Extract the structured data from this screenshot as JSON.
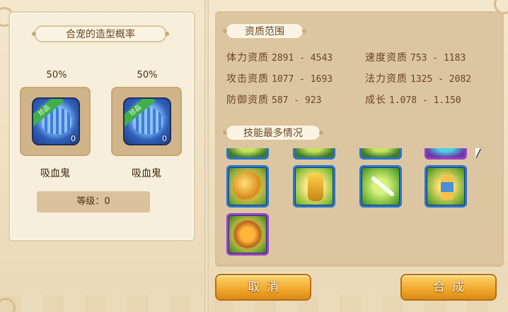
{
  "left": {
    "rate_title": "合宠的造型概率",
    "pets": [
      {
        "rate": "50%",
        "badge": "珍品",
        "count": "0",
        "name": "吸血鬼"
      },
      {
        "rate": "50%",
        "badge": "珍品",
        "count": "0",
        "name": "吸血鬼"
      }
    ],
    "level": "等级：0"
  },
  "right": {
    "aptitude_title": "资质范围",
    "stats": [
      {
        "label": "体力资质",
        "value": "2891 - 4543"
      },
      {
        "label": "速度资质",
        "value": "753 - 1183"
      },
      {
        "label": "攻击资质",
        "value": "1077 - 1693"
      },
      {
        "label": "法力资质",
        "value": "1325 - 2082"
      },
      {
        "label": "防御资质",
        "value": "587 - 923"
      },
      {
        "label": "成长",
        "value": "1.078 - 1.150"
      }
    ],
    "skills_title": "技能最多情况",
    "skill_icons": [
      "partial-green-skill-icon",
      "partial-green-skill-icon",
      "partial-green-skill-icon",
      "partial-cyan-skill-icon",
      "golden-dragon-skill-icon",
      "buddha-statue-skill-icon",
      "blade-strike-skill-icon",
      "hourglass-skill-icon",
      "fire-orb-skill-icon"
    ]
  },
  "buttons": {
    "cancel": "取消",
    "confirm": "合成"
  },
  "colors": {
    "button": "#f0a72a",
    "skill_border": "#2b74c9",
    "skill_border_rare": "#9b3fc6"
  }
}
